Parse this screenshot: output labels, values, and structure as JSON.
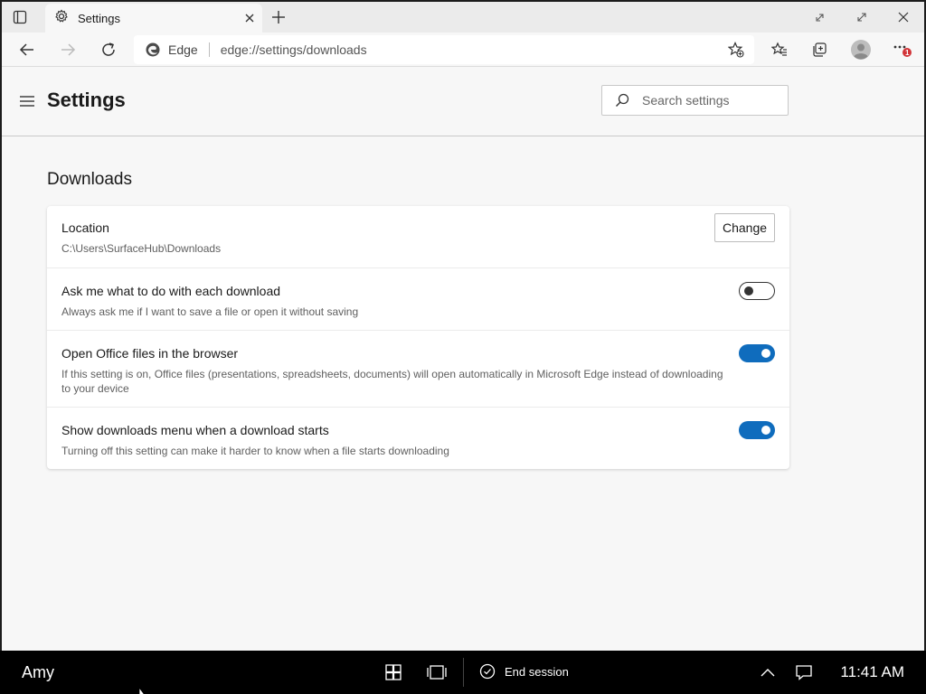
{
  "browser": {
    "tab_title": "Settings",
    "address_brand": "Edge",
    "url": "edge://settings/downloads",
    "menu_badge": "1"
  },
  "settings": {
    "title": "Settings",
    "search_placeholder": "Search settings"
  },
  "downloads": {
    "section_title": "Downloads",
    "location": {
      "title": "Location",
      "path": "C:\\Users\\SurfaceHub\\Downloads",
      "change_label": "Change"
    },
    "items": [
      {
        "title": "Ask me what to do with each download",
        "description": "Always ask me if I want to save a file or open it without saving",
        "enabled": false
      },
      {
        "title": "Open Office files in the browser",
        "description": "If this setting is on, Office files (presentations, spreadsheets, documents) will open automatically in Microsoft Edge instead of downloading to your device",
        "enabled": true
      },
      {
        "title": "Show downloads menu when a download starts",
        "description": "Turning off this setting can make it harder to know when a file starts downloading",
        "enabled": true
      }
    ]
  },
  "taskbar": {
    "user": "Amy",
    "end_session": "End session",
    "time": "11:41 AM"
  },
  "colors": {
    "toggle_on": "#0f6cbd",
    "page_bg": "#f7f7f7",
    "badge": "#d13438"
  },
  "icons": [
    "tab-actions-icon",
    "settings-gear-icon",
    "close-icon",
    "plus-icon",
    "back-arrow-icon",
    "forward-arrow-icon",
    "refresh-icon",
    "edge-logo-icon",
    "add-favorite-icon",
    "favorites-icon",
    "collections-icon",
    "profile-icon",
    "more-icon",
    "hamburger-icon",
    "search-icon",
    "windows-icon",
    "task-view-icon",
    "checkmark-circle-icon",
    "chevron-up-icon",
    "notification-icon"
  ]
}
